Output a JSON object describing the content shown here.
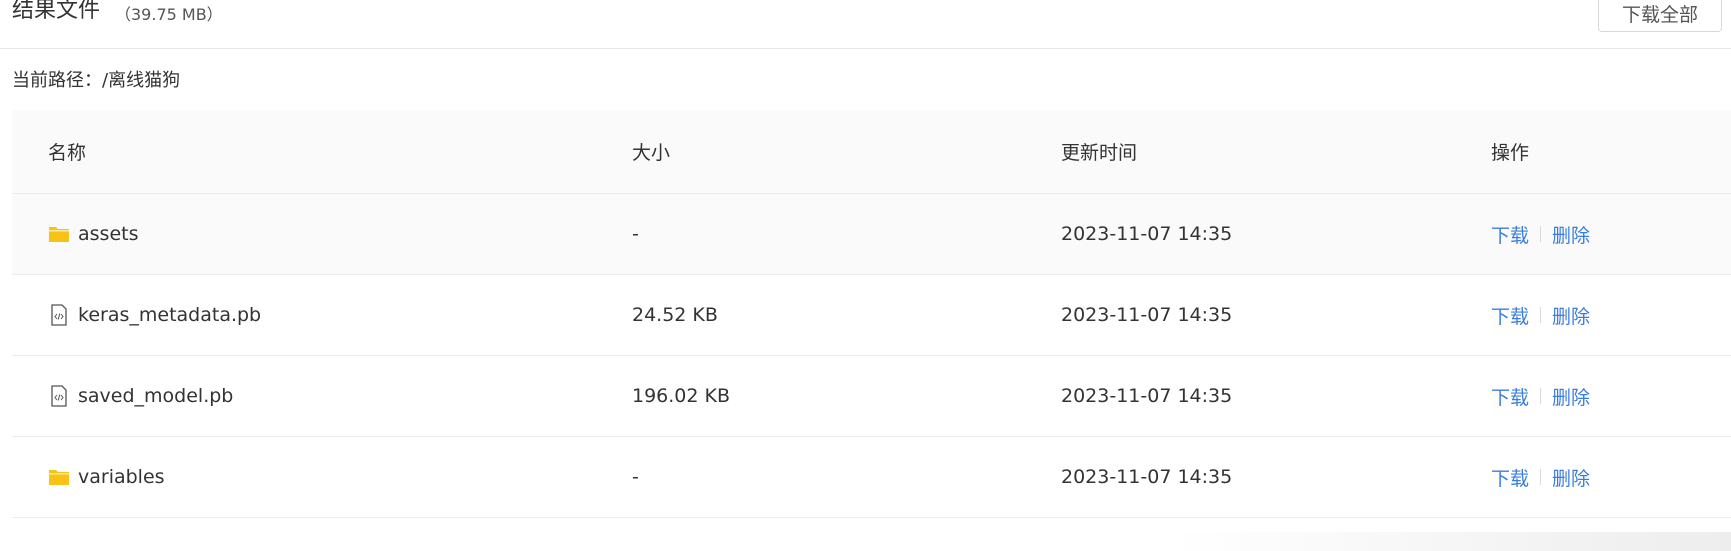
{
  "header": {
    "title": "结果文件",
    "size": "（39.75 MB）",
    "download_all_label": "下载全部"
  },
  "path": {
    "label": "当前路径：/离线猫狗"
  },
  "table": {
    "columns": [
      "名称",
      "大小",
      "更新时间",
      "操作"
    ],
    "rows": [
      {
        "icon": "folder-icon",
        "name": "assets",
        "size": "-",
        "updated": "2023-11-07 14:35",
        "download": "下载",
        "delete": "删除"
      },
      {
        "icon": "code-file-icon",
        "name": "keras_metadata.pb",
        "size": "24.52 KB",
        "updated": "2023-11-07 14:35",
        "download": "下载",
        "delete": "删除"
      },
      {
        "icon": "code-file-icon",
        "name": "saved_model.pb",
        "size": "196.02 KB",
        "updated": "2023-11-07 14:35",
        "download": "下载",
        "delete": "删除"
      },
      {
        "icon": "folder-icon",
        "name": "variables",
        "size": "-",
        "updated": "2023-11-07 14:35",
        "download": "下载",
        "delete": "删除"
      }
    ]
  },
  "colors": {
    "link": "#3a7de0",
    "folder": "#f7c316",
    "header_bg": "#fafafa"
  }
}
